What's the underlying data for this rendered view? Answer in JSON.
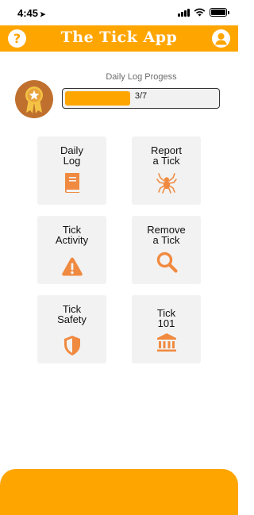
{
  "status_bar": {
    "time": "4:45",
    "location_glyph": "➤"
  },
  "header": {
    "title": "The Tick App",
    "help_label": "?",
    "help_icon": "question-circle-icon",
    "profile_icon": "user-circle-icon"
  },
  "progress": {
    "label": "Daily Log Progess",
    "text": "3/7",
    "completed": 3,
    "total": 7,
    "fraction": 0.4286
  },
  "badge": {
    "icon": "award-badge-icon"
  },
  "tiles": [
    {
      "label": "Daily\nLog",
      "icon": "book-icon"
    },
    {
      "label": "Report\na Tick",
      "icon": "spider-icon"
    },
    {
      "label": "Tick\nActivity",
      "icon": "warning-icon"
    },
    {
      "label": "Remove\na Tick",
      "icon": "magnifier-icon"
    },
    {
      "label": "Tick\nSafety",
      "icon": "shield-icon"
    },
    {
      "label": "Tick\n101",
      "icon": "institution-icon"
    }
  ],
  "colors": {
    "accent": "#ffa500",
    "icon": "#f08a40",
    "tile_bg": "#f2f2f2",
    "badge_ring": "#c0702e",
    "badge_inner": "#e8b24a"
  }
}
